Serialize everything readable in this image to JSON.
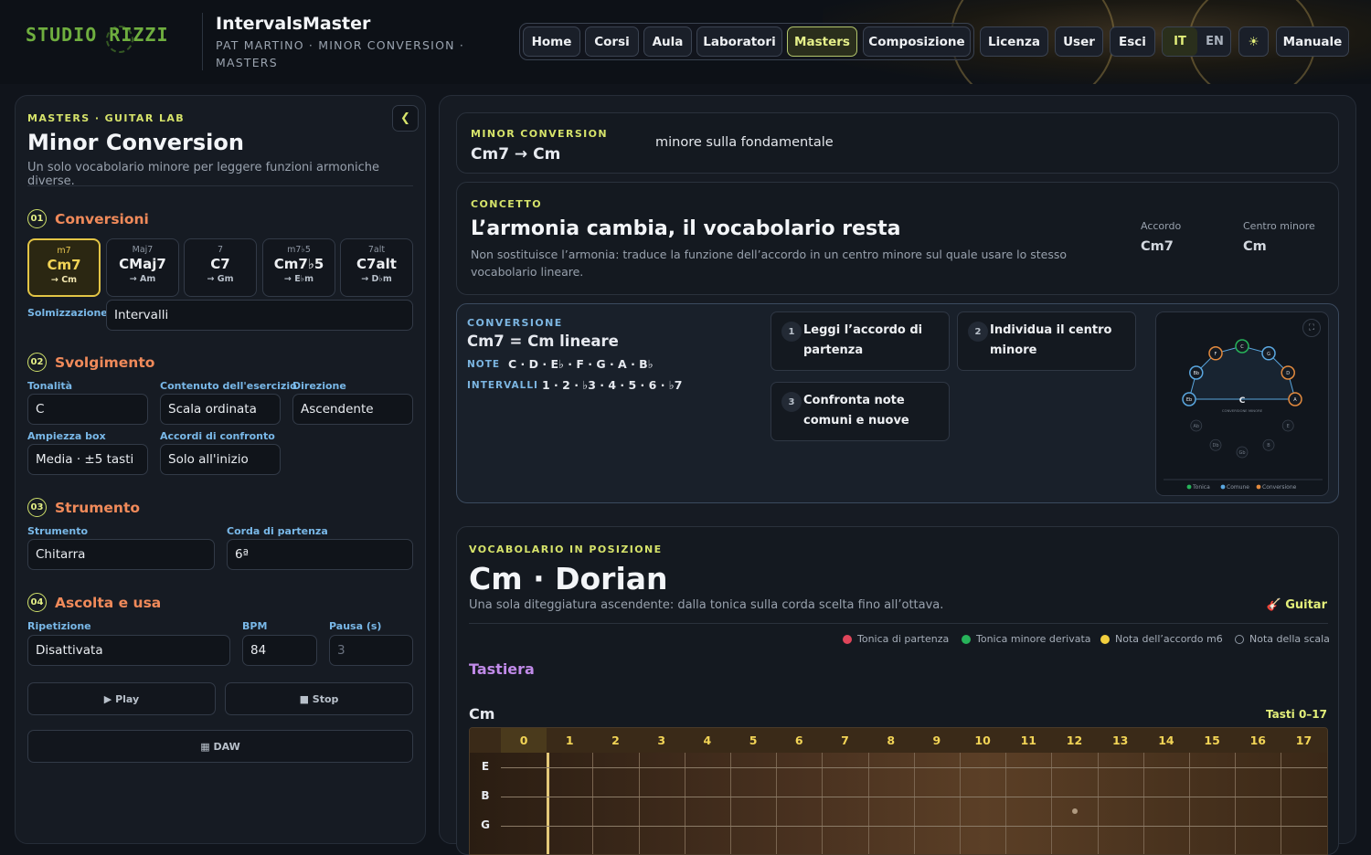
{
  "header": {
    "logo": "STUDIO RIZZI",
    "title": "IntervalsMaster",
    "subtitle": "PAT MARTINO · MINOR CONVERSION · MASTERS"
  },
  "nav": {
    "items": [
      "Home",
      "Corsi",
      "Aula",
      "Laboratori",
      "Masters",
      "Composizione"
    ],
    "active": "Masters",
    "licenza": "Licenza",
    "user": "User",
    "esci": "Esci",
    "lang_it": "IT",
    "lang_en": "EN",
    "theme_icon": "☀",
    "manuale": "Manuale"
  },
  "sidebar": {
    "kicker": "MASTERS · GUITAR LAB",
    "title": "Minor Conversion",
    "desc": "Un solo vocabolario minore per leggere funzioni armoniche diverse.",
    "collapse": "❮",
    "s1": {
      "num": "01",
      "title": "Conversioni"
    },
    "conversions": [
      {
        "type": "m7",
        "chord": "Cm7",
        "to": "→ Cm"
      },
      {
        "type": "Maj7",
        "chord": "CMaj7",
        "to": "→ Am"
      },
      {
        "type": "7",
        "chord": "C7",
        "to": "→ Gm"
      },
      {
        "type": "m7♭5",
        "chord": "Cm7♭5",
        "to": "→ E♭m"
      },
      {
        "type": "7alt",
        "chord": "C7alt",
        "to": "→ D♭m"
      }
    ],
    "solmization_label": "Solmizzazione",
    "solmization_value": "Intervalli",
    "s2": {
      "num": "02",
      "title": "Svolgimento"
    },
    "tonalita_label": "Tonalità",
    "tonalita_value": "C",
    "contenuto_label": "Contenuto dell'esercizio",
    "contenuto_value": "Scala ordinata",
    "direzione_label": "Direzione",
    "direzione_value": "Ascendente",
    "ampiezza_label": "Ampiezza box",
    "ampiezza_value": "Media · ±5 tasti",
    "accordi_label": "Accordi di confronto",
    "accordi_value": "Solo all'inizio",
    "s3": {
      "num": "03",
      "title": "Strumento"
    },
    "strumento_label": "Strumento",
    "strumento_value": "Chitarra",
    "corda_label": "Corda di partenza",
    "corda_value": "6ª",
    "s4": {
      "num": "04",
      "title": "Ascolta e usa"
    },
    "ripetizione_label": "Ripetizione",
    "ripetizione_value": "Disattivata",
    "bpm_label": "BPM",
    "bpm_value": "84",
    "pausa_label": "Pausa (s)",
    "pausa_value": "3",
    "play": "▶ Play",
    "stop": "■ Stop",
    "daw": "▦ DAW"
  },
  "main": {
    "summary": {
      "kicker": "MINOR CONVERSION",
      "chord": "Cm7 → Cm",
      "desc": "minore sulla fondamentale"
    },
    "concept": {
      "kicker": "CONCETTO",
      "title": "L’armonia cambia, il vocabolario resta",
      "desc": "Non sostituisce l’armonia: traduce la funzione dell’accordo in un centro minore sul quale usare lo stesso vocabolario lineare.",
      "accordo_label": "Accordo",
      "accordo_value": "Cm7",
      "centro_label": "Centro minore",
      "centro_value": "Cm"
    },
    "conversion": {
      "kicker": "CONVERSIONE",
      "title": "Cm7 = Cm lineare",
      "note_label": "NOTE",
      "note_value": "C · D · E♭ · F · G · A · B♭",
      "int_label": "INTERVALLI",
      "int_value": "1 · 2 · ♭3 · 4 · 5 · 6 · ♭7",
      "steps": [
        {
          "n": "1",
          "text": "Leggi l’accordo di partenza"
        },
        {
          "n": "2",
          "text": "Individua il centro minore"
        },
        {
          "n": "3",
          "text": "Confronta note comuni e nuove"
        }
      ],
      "circle": {
        "center": "C",
        "center_sub": "CONVERSIONE MINORE",
        "notes": [
          "C",
          "G",
          "D",
          "A",
          "E",
          "B",
          "Gb",
          "Db",
          "Ab",
          "Eb",
          "Bb",
          "F"
        ],
        "active_notes": [
          "F",
          "C",
          "G",
          "D",
          "A",
          "Eb",
          "Bb"
        ],
        "legend": [
          "Tonica",
          "Comune",
          "Conversione"
        ],
        "expand_icon": "⛶"
      }
    },
    "vocab": {
      "kicker": "VOCABOLARIO IN POSIZIONE",
      "title": "Cm · Dorian",
      "desc": "Una sola diteggiatura ascendente: dalla tonica sulla corda scelta fino all’ottava.",
      "guitar": "🎸 Guitar",
      "legend": [
        {
          "label": "Tonica di partenza",
          "color": "#e0455a"
        },
        {
          "label": "Tonica minore derivata",
          "color": "#27b35a"
        },
        {
          "label": "Nota dell’accordo m6",
          "color": "#f2cf3e"
        },
        {
          "label": "Nota della scala",
          "color": "transparent"
        }
      ],
      "tastiera": "Tastiera",
      "board_key": "Cm",
      "frets_range": "Tasti 0–17",
      "frets": [
        "0",
        "1",
        "2",
        "3",
        "4",
        "5",
        "6",
        "7",
        "8",
        "9",
        "10",
        "11",
        "12",
        "13",
        "14",
        "15",
        "16",
        "17"
      ],
      "strings": [
        "E",
        "B",
        "G"
      ]
    }
  }
}
